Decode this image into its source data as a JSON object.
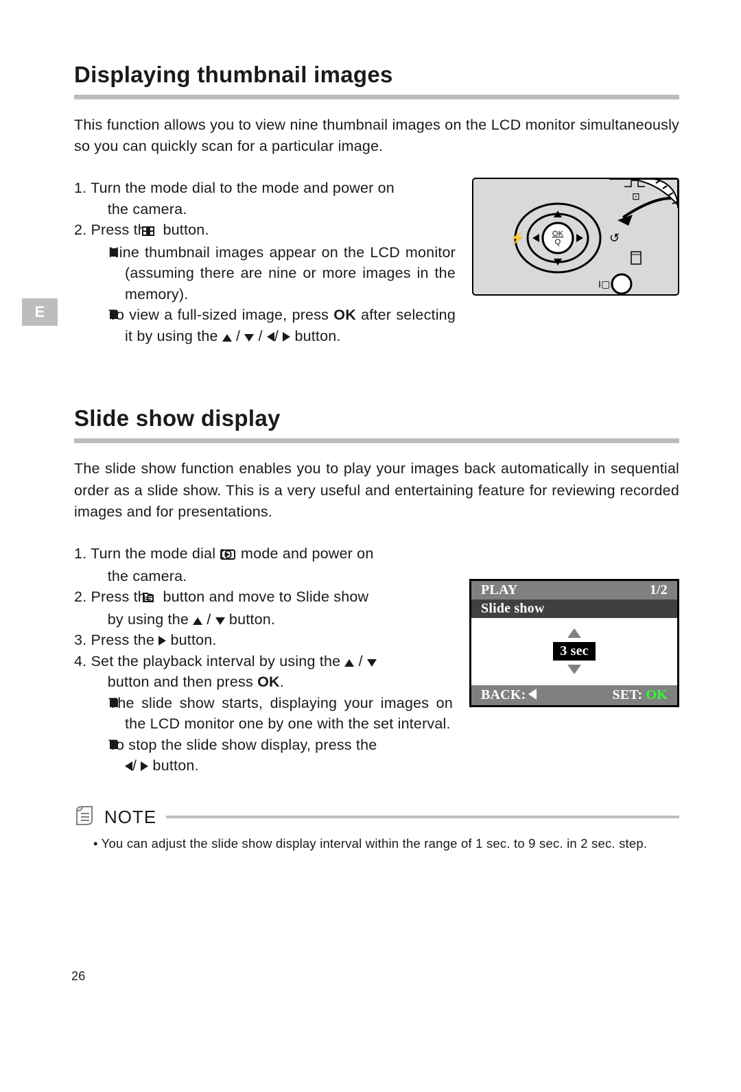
{
  "side_tab": "E",
  "page_number": "26",
  "section1": {
    "title": "Displaying thumbnail images",
    "intro": "This function allows you to view nine thumbnail images on the LCD monitor simultaneously so you can quickly scan for a particular image.",
    "step1_a": "1. Turn the mode dial to the mode and power on",
    "step1_b": "the camera.",
    "step2_a": "2. Press the ",
    "step2_b": " button.",
    "sub1": "Nine thumbnail images appear on the LCD monitor (assuming there are nine or more images in the memory).",
    "sub2_a": "To view a full-sized image, press ",
    "sub2_ok": "OK",
    "sub2_b": " after selecting it by using the ",
    "sub2_c": " button."
  },
  "section2": {
    "title": "Slide show display",
    "intro": "The slide show function enables you to play your images back automatically in sequential order as a slide show. This is a very useful and entertaining feature for reviewing recorded images and for presentations.",
    "step1_a": "1. Turn the mode dial to ",
    "step1_b": " mode and power on",
    "step1_c": "the camera.",
    "step2_a": "2. Press the ",
    "step2_b": " button and move to Slide show",
    "step2_c": "by using the ",
    "step2_d": " button.",
    "step3_a": "3. Press the ",
    "step3_b": " button.",
    "step4_a": "4. Set the playback interval by using the ",
    "step4_b": "button and then press ",
    "step4_ok": "OK",
    "step4_c": ".",
    "sub1": "The slide show starts, displaying your images on the LCD monitor one by one with the set interval.",
    "sub2_a": "To stop the slide show display, press the ",
    "sub2_b": " button."
  },
  "lcd": {
    "title": "PLAY",
    "page": "1/2",
    "subtitle": "Slide show",
    "interval": "3 sec",
    "back_label": "BACK:",
    "set_label": "SET: ",
    "set_ok": "OK"
  },
  "note": {
    "label": "NOTE",
    "text": "• You can adjust the slide show display interval within the range of 1 sec. to 9 sec. in 2 sec. step."
  }
}
